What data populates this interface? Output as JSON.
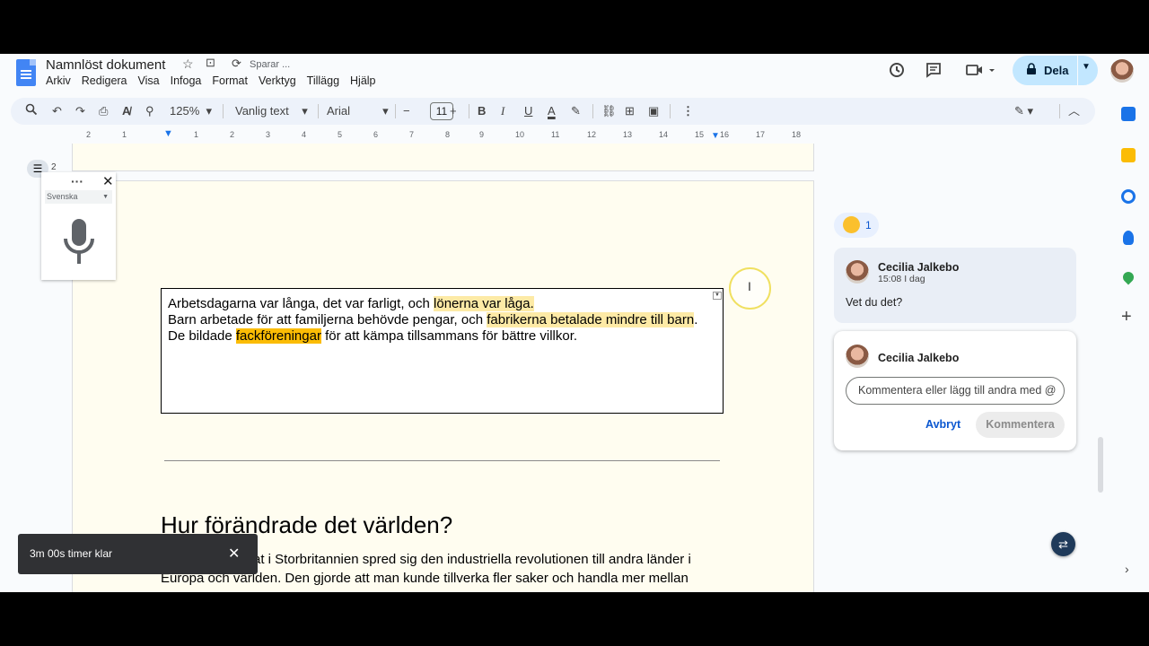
{
  "app": {
    "title": "Namnlöst dokument",
    "saving": "Sparar ...",
    "menu": [
      "Arkiv",
      "Redigera",
      "Visa",
      "Infoga",
      "Format",
      "Verktyg",
      "Tillägg",
      "Hjälp"
    ],
    "share_label": "Dela"
  },
  "toolbar": {
    "zoom": "125%",
    "style": "Vanlig text",
    "font": "Arial",
    "font_size": "11"
  },
  "ruler": {
    "labels": [
      "2",
      "1",
      "1",
      "2",
      "3",
      "4",
      "5",
      "6",
      "7",
      "8",
      "9",
      "10",
      "11",
      "12",
      "13",
      "14",
      "15",
      "16",
      "17",
      "18"
    ]
  },
  "outline": {
    "count": "2"
  },
  "voice": {
    "language": "Svenska"
  },
  "textbox": {
    "line1_pre": "Arbetsdagarna var långa, det var farligt, och ",
    "line1_hl": "lönerna var låga.",
    "line2_pre": "Barn arbetade för att familjerna behövde pengar, och ",
    "line2_hl": "fabrikerna betalade mindre till barn",
    "line2_post": ".",
    "line3_pre": "De bildade ",
    "line3_hl": "fackföreningar",
    "line3_post": " för att kämpa tillsammans för bättre villkor."
  },
  "doc": {
    "heading": "Hur förändrade det världen?",
    "para_line1": "at i Storbritannien spred sig den industriella revolutionen till andra länder i",
    "para_line2": "Europa och världen. Den gjorde att man kunde tillverka fler saker och handla mer mellan"
  },
  "toast": {
    "message": "3m 00s timer klar"
  },
  "comments": {
    "reaction_count": "1",
    "thread": {
      "author": "Cecilia Jalkebo",
      "time": "15:08 I dag",
      "text": "Vet du det?"
    },
    "reply": {
      "author": "Cecilia Jalkebo",
      "placeholder": "Kommentera eller lägg till andra med @",
      "cancel": "Avbryt",
      "submit": "Kommentera"
    }
  }
}
